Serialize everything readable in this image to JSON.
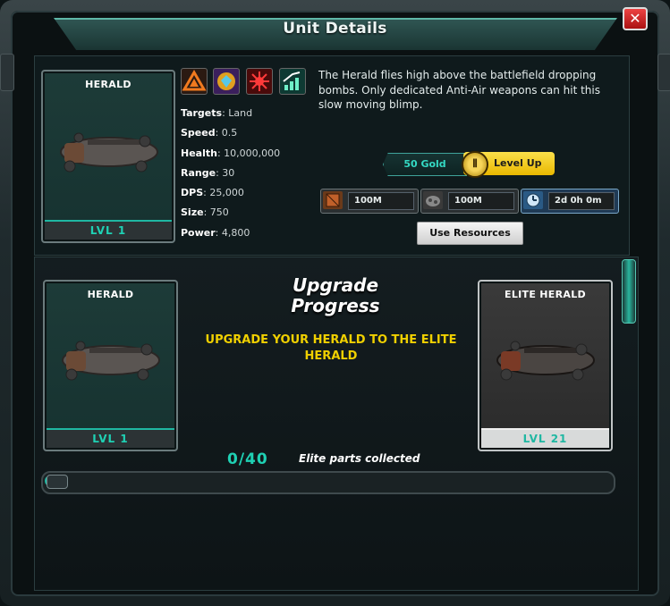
{
  "window": {
    "title": "Unit Details",
    "close_label": "✕"
  },
  "unit": {
    "name": "HERALD",
    "level": "LVL 1",
    "stats": [
      {
        "label": "Targets",
        "value": "Land"
      },
      {
        "label": "Speed",
        "value": "0.5"
      },
      {
        "label": "Health",
        "value": "10,000,000"
      },
      {
        "label": "Range",
        "value": "30"
      },
      {
        "label": "DPS",
        "value": "25,000"
      },
      {
        "label": "Size",
        "value": "750"
      },
      {
        "label": "Power",
        "value": "4,800"
      }
    ],
    "description": "The Herald flies high above the battlefield dropping bombs. Only dedicated Anti-Air weapons can hit this slow moving blimp.",
    "trait_icons": [
      "triangle-warning-icon",
      "diamond-shield-icon",
      "red-burst-icon",
      "speed-arrow-icon"
    ]
  },
  "level_up": {
    "cost": "50 Gold",
    "button": "Level Up",
    "coin_icon": "coin-icon"
  },
  "resources": [
    {
      "icon": "crate-icon",
      "value": "100M"
    },
    {
      "icon": "ore-icon",
      "value": "100M"
    },
    {
      "icon": "clock-icon",
      "value": "2d 0h 0m"
    }
  ],
  "use_resources_button": "Use Resources",
  "upgrade": {
    "title_line1": "Upgrade",
    "title_line2": "Progress",
    "subtitle": "UPGRADE YOUR HERALD TO THE ELITE HERALD",
    "current": {
      "name": "HERALD",
      "level": "LVL 1"
    },
    "elite": {
      "name": "ELITE HERALD",
      "level": "LVL 21"
    },
    "counter": "0/40",
    "parts_label": "Elite parts collected",
    "progress_fraction": 0.0
  },
  "colors": {
    "accent_teal": "#1fd1b4",
    "gold": "#f0d000",
    "close_red": "#d62b2b"
  }
}
